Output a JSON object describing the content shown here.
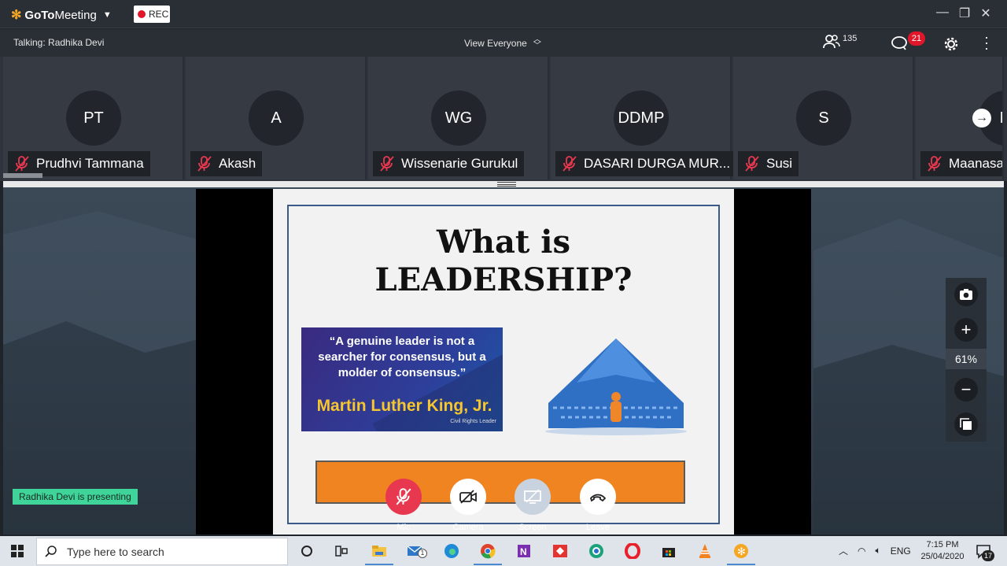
{
  "app": {
    "name_goto": "GoTo",
    "name_meeting": "Meeting",
    "rec_label": "REC",
    "window_controls": [
      "minimize-icon",
      "restore-icon",
      "close-icon"
    ]
  },
  "toolbar": {
    "talking": "Talking: Radhika Devi",
    "view_label": "View Everyone",
    "attendee_count": "135",
    "chat_badge": "21"
  },
  "participants": [
    {
      "initials": "PT",
      "name": "Prudhvi Tammana"
    },
    {
      "initials": "A",
      "name": "Akash"
    },
    {
      "initials": "WG",
      "name": "Wissenarie Gurukul"
    },
    {
      "initials": "DDMP",
      "name": "DASARI DURGA MUR..."
    },
    {
      "initials": "S",
      "name": "Susi"
    },
    {
      "initials": "M",
      "name": "Maanasa"
    }
  ],
  "slide": {
    "title_line1": "What is",
    "title_line2": "LEADERSHIP?",
    "quote": "“A genuine leader is not a searcher for consensus, but a molder of consensus.”",
    "quote_author": "Martin Luther King, Jr.",
    "quote_sub": "Civil Rights Leader"
  },
  "presenter_badge": "Radhika Devi is presenting",
  "zoom": {
    "level": "61%"
  },
  "controls": [
    {
      "label": "Mic",
      "color": "#e8384f"
    },
    {
      "label": "Camera",
      "color": "#ffffff"
    },
    {
      "label": "Screen",
      "color": "#c9d3df"
    },
    {
      "label": "Leave",
      "color": "#ffffff"
    }
  ],
  "taskbar": {
    "search_placeholder": "Type here to search",
    "language": "ENG",
    "time": "7:15 PM",
    "date": "25/04/2020",
    "notifications": "17",
    "mail_badge": "1"
  }
}
